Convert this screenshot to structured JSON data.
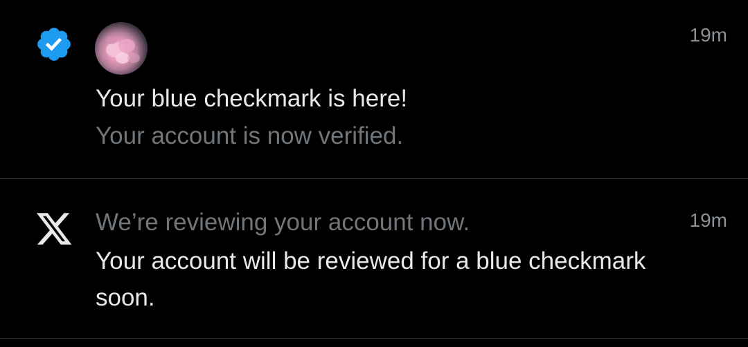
{
  "notifications": [
    {
      "icon": "verified-badge-icon",
      "icon_color": "#1d9bf0",
      "avatar": "user-avatar",
      "time": "19m",
      "title": "Your blue checkmark is here!",
      "subtitle": "Your account is now verified."
    },
    {
      "icon": "x-logo-icon",
      "time": "19m",
      "title": "We’re reviewing your account now.",
      "body": "Your account will be reviewed for a blue checkmark soon."
    }
  ],
  "colors": {
    "background": "#000000",
    "primary_text": "#e7e9ea",
    "secondary_text": "#71767b",
    "divider": "#2f3336",
    "accent": "#1d9bf0"
  }
}
